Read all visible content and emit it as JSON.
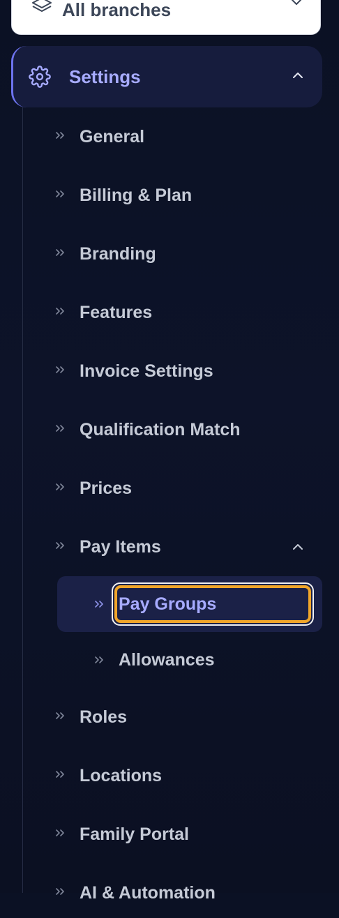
{
  "branch_selector": {
    "label": "All branches",
    "icon": "layers-icon"
  },
  "settings_section": {
    "label": "Settings",
    "icon": "gear-icon",
    "expanded": true,
    "accent_color": "#6d73ee",
    "label_color": "#a7abff"
  },
  "menu": {
    "general": "General",
    "billing": "Billing & Plan",
    "branding": "Branding",
    "features": "Features",
    "invoice_settings": "Invoice Settings",
    "qualification_match": "Qualification Match",
    "prices": "Prices",
    "pay_items": "Pay Items",
    "pay_groups": "Pay Groups",
    "allowances": "Allowances",
    "roles": "Roles",
    "locations": "Locations",
    "family_portal": "Family Portal",
    "ai_automation": "AI & Automation"
  },
  "active_item": "Pay Groups",
  "focus_color": "#f0a52a"
}
